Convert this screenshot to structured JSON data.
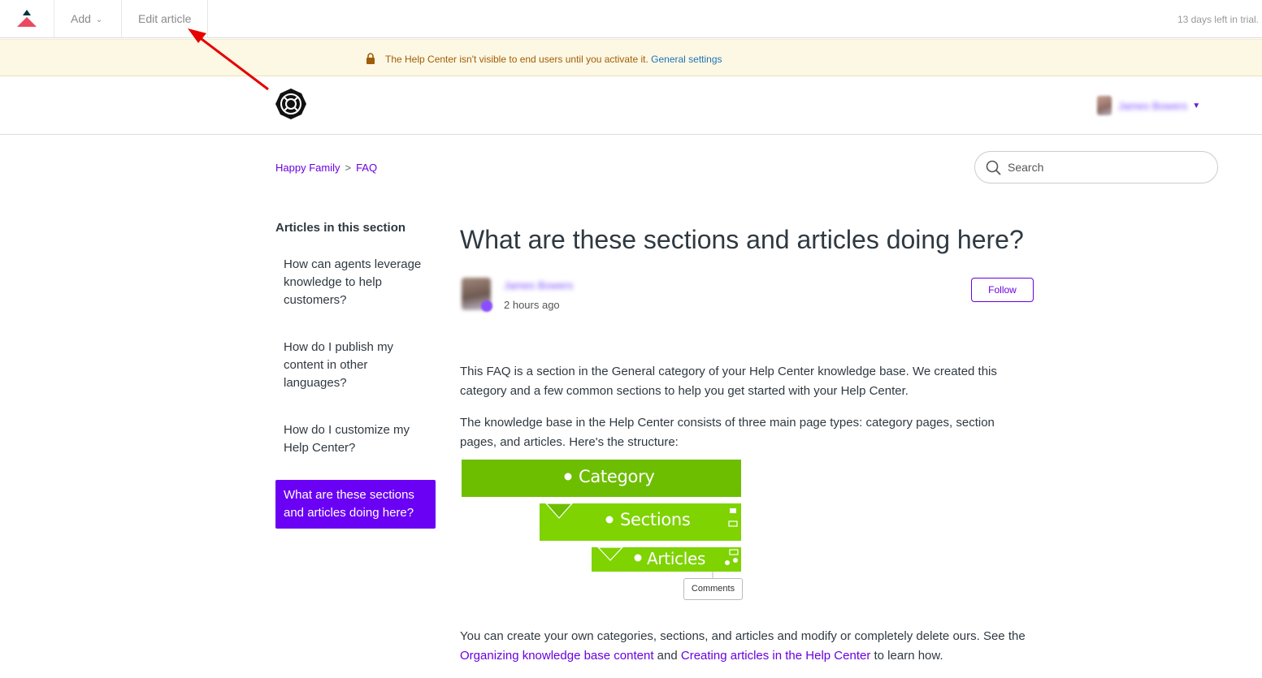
{
  "topbar": {
    "add_label": "Add",
    "edit_label": "Edit article",
    "trial_text": "13 days left in trial."
  },
  "notice": {
    "text": "The Help Center isn't visible to end users until you activate it.",
    "link": "General settings",
    "color": "#a15c06"
  },
  "header": {
    "user_name": "James Bowers"
  },
  "breadcrumbs": [
    "Happy Family",
    "FAQ"
  ],
  "search": {
    "placeholder": "Search"
  },
  "sidebar": {
    "title": "Articles in this section",
    "items": [
      "How can agents leverage knowledge to help customers?",
      "How do I publish my content in other languages?",
      "How do I customize my Help Center?",
      "What are these sections and articles doing here?"
    ]
  },
  "article": {
    "title": "What are these sections and articles doing here?",
    "author": "James Bowers",
    "time": "2 hours ago",
    "follow_label": "Follow",
    "p1": "This FAQ is a section in the General category of your Help Center knowledge base. We created this category and a few common sections to help you get started with your Help Center.",
    "p2": "The knowledge base in the Help Center consists of three main page types: category pages, section pages, and articles. Here's the structure:",
    "diagram": {
      "category": "Category",
      "sections": "Sections",
      "articles": "Articles",
      "comments": "Comments"
    },
    "p3_start": "You can create your own categories, sections, and articles and modify or completely delete ours. See the",
    "link1": "Organizing knowledge base content",
    "and": "and",
    "link2": "Creating articles in the Help Center",
    "p3_end": "to learn how."
  },
  "colors": {
    "accent": "#6a00f4",
    "link": "#6a00e0",
    "category_green": "#6dbe00",
    "section_green": "#7ed300",
    "annotation_red": "#e60000"
  }
}
